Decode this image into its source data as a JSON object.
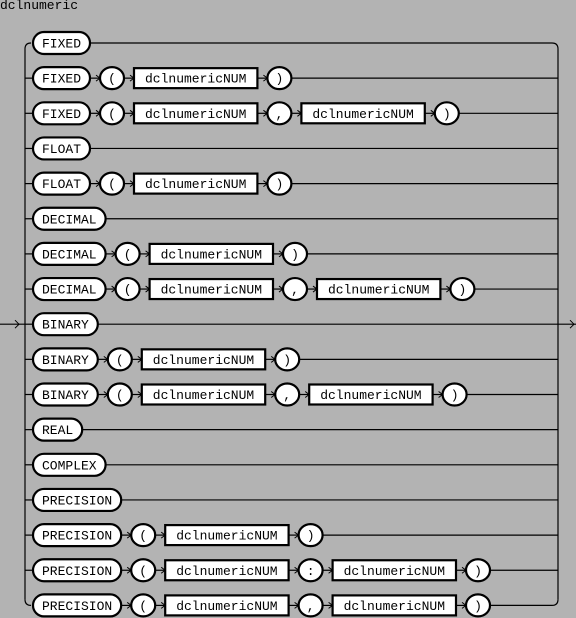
{
  "title": "dclnumeric",
  "nonterminal_ref": "dclnumericNUM",
  "rows": [
    {
      "keyword": "FIXED",
      "seq": []
    },
    {
      "keyword": "FIXED",
      "seq": [
        "(",
        "@NUM",
        ")"
      ]
    },
    {
      "keyword": "FIXED",
      "seq": [
        "(",
        "@NUM",
        ",",
        "@NUM",
        ")"
      ]
    },
    {
      "keyword": "FLOAT",
      "seq": []
    },
    {
      "keyword": "FLOAT",
      "seq": [
        "(",
        "@NUM",
        ")"
      ]
    },
    {
      "keyword": "DECIMAL",
      "seq": []
    },
    {
      "keyword": "DECIMAL",
      "seq": [
        "(",
        "@NUM",
        ")"
      ]
    },
    {
      "keyword": "DECIMAL",
      "seq": [
        "(",
        "@NUM",
        ",",
        "@NUM",
        ")"
      ]
    },
    {
      "keyword": "BINARY",
      "seq": []
    },
    {
      "keyword": "BINARY",
      "seq": [
        "(",
        "@NUM",
        ")"
      ]
    },
    {
      "keyword": "BINARY",
      "seq": [
        "(",
        "@NUM",
        ",",
        "@NUM",
        ")"
      ]
    },
    {
      "keyword": "REAL",
      "seq": []
    },
    {
      "keyword": "COMPLEX",
      "seq": []
    },
    {
      "keyword": "PRECISION",
      "seq": []
    },
    {
      "keyword": "PRECISION",
      "seq": [
        "(",
        "@NUM",
        ")"
      ]
    },
    {
      "keyword": "PRECISION",
      "seq": [
        "(",
        "@NUM",
        ":",
        "@NUM",
        ")"
      ]
    },
    {
      "keyword": "PRECISION",
      "seq": [
        "(",
        "@NUM",
        ",",
        "@NUM",
        ")"
      ]
    }
  ],
  "main_row_index": 8
}
